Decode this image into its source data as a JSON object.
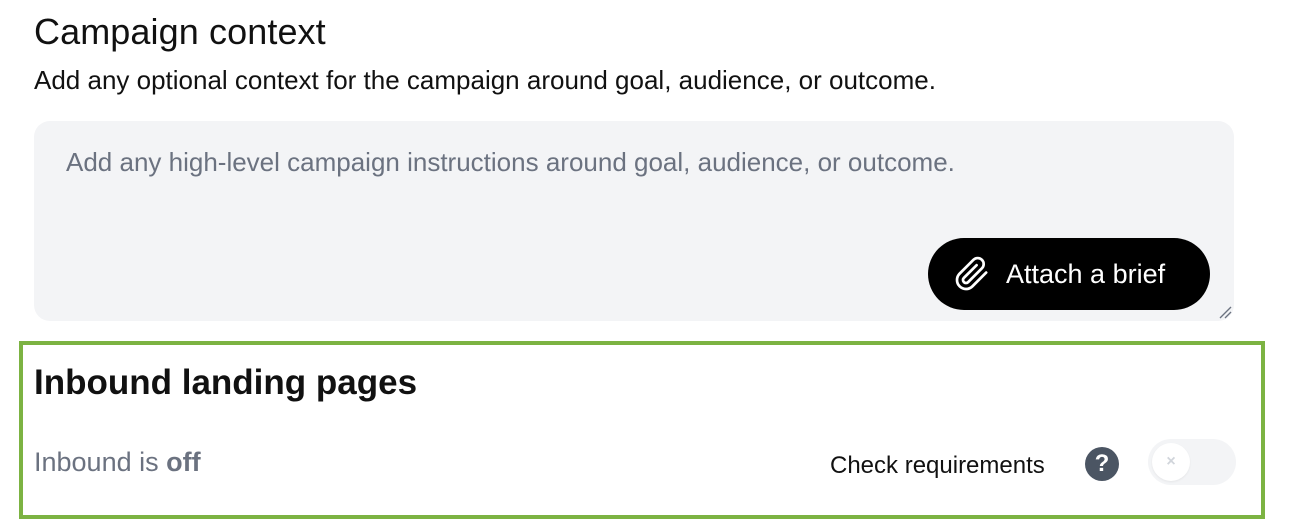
{
  "campaign_context": {
    "title": "Campaign context",
    "subtitle": "Add any optional context for the campaign around goal, audience, or outcome.",
    "input": {
      "value": "",
      "placeholder": "Add any high-level campaign instructions around goal, audience, or outcome."
    },
    "attach_button_label": "Attach a brief",
    "icons": {
      "attach": "paperclip-icon",
      "resize": "resize-grip-icon"
    }
  },
  "inbound": {
    "title": "Inbound landing pages",
    "status_prefix": "Inbound is",
    "status_value": "off",
    "check_requirements_label": "Check requirements",
    "help_symbol": "?",
    "toggle_on": false,
    "toggle_symbol": "×",
    "icons": {
      "help": "question-circle-icon"
    }
  },
  "colors": {
    "highlight_border": "#7cb342",
    "button_bg": "#000000",
    "input_bg": "#f3f4f6",
    "muted_text": "#6b7280",
    "help_icon_bg": "#4b5563"
  }
}
